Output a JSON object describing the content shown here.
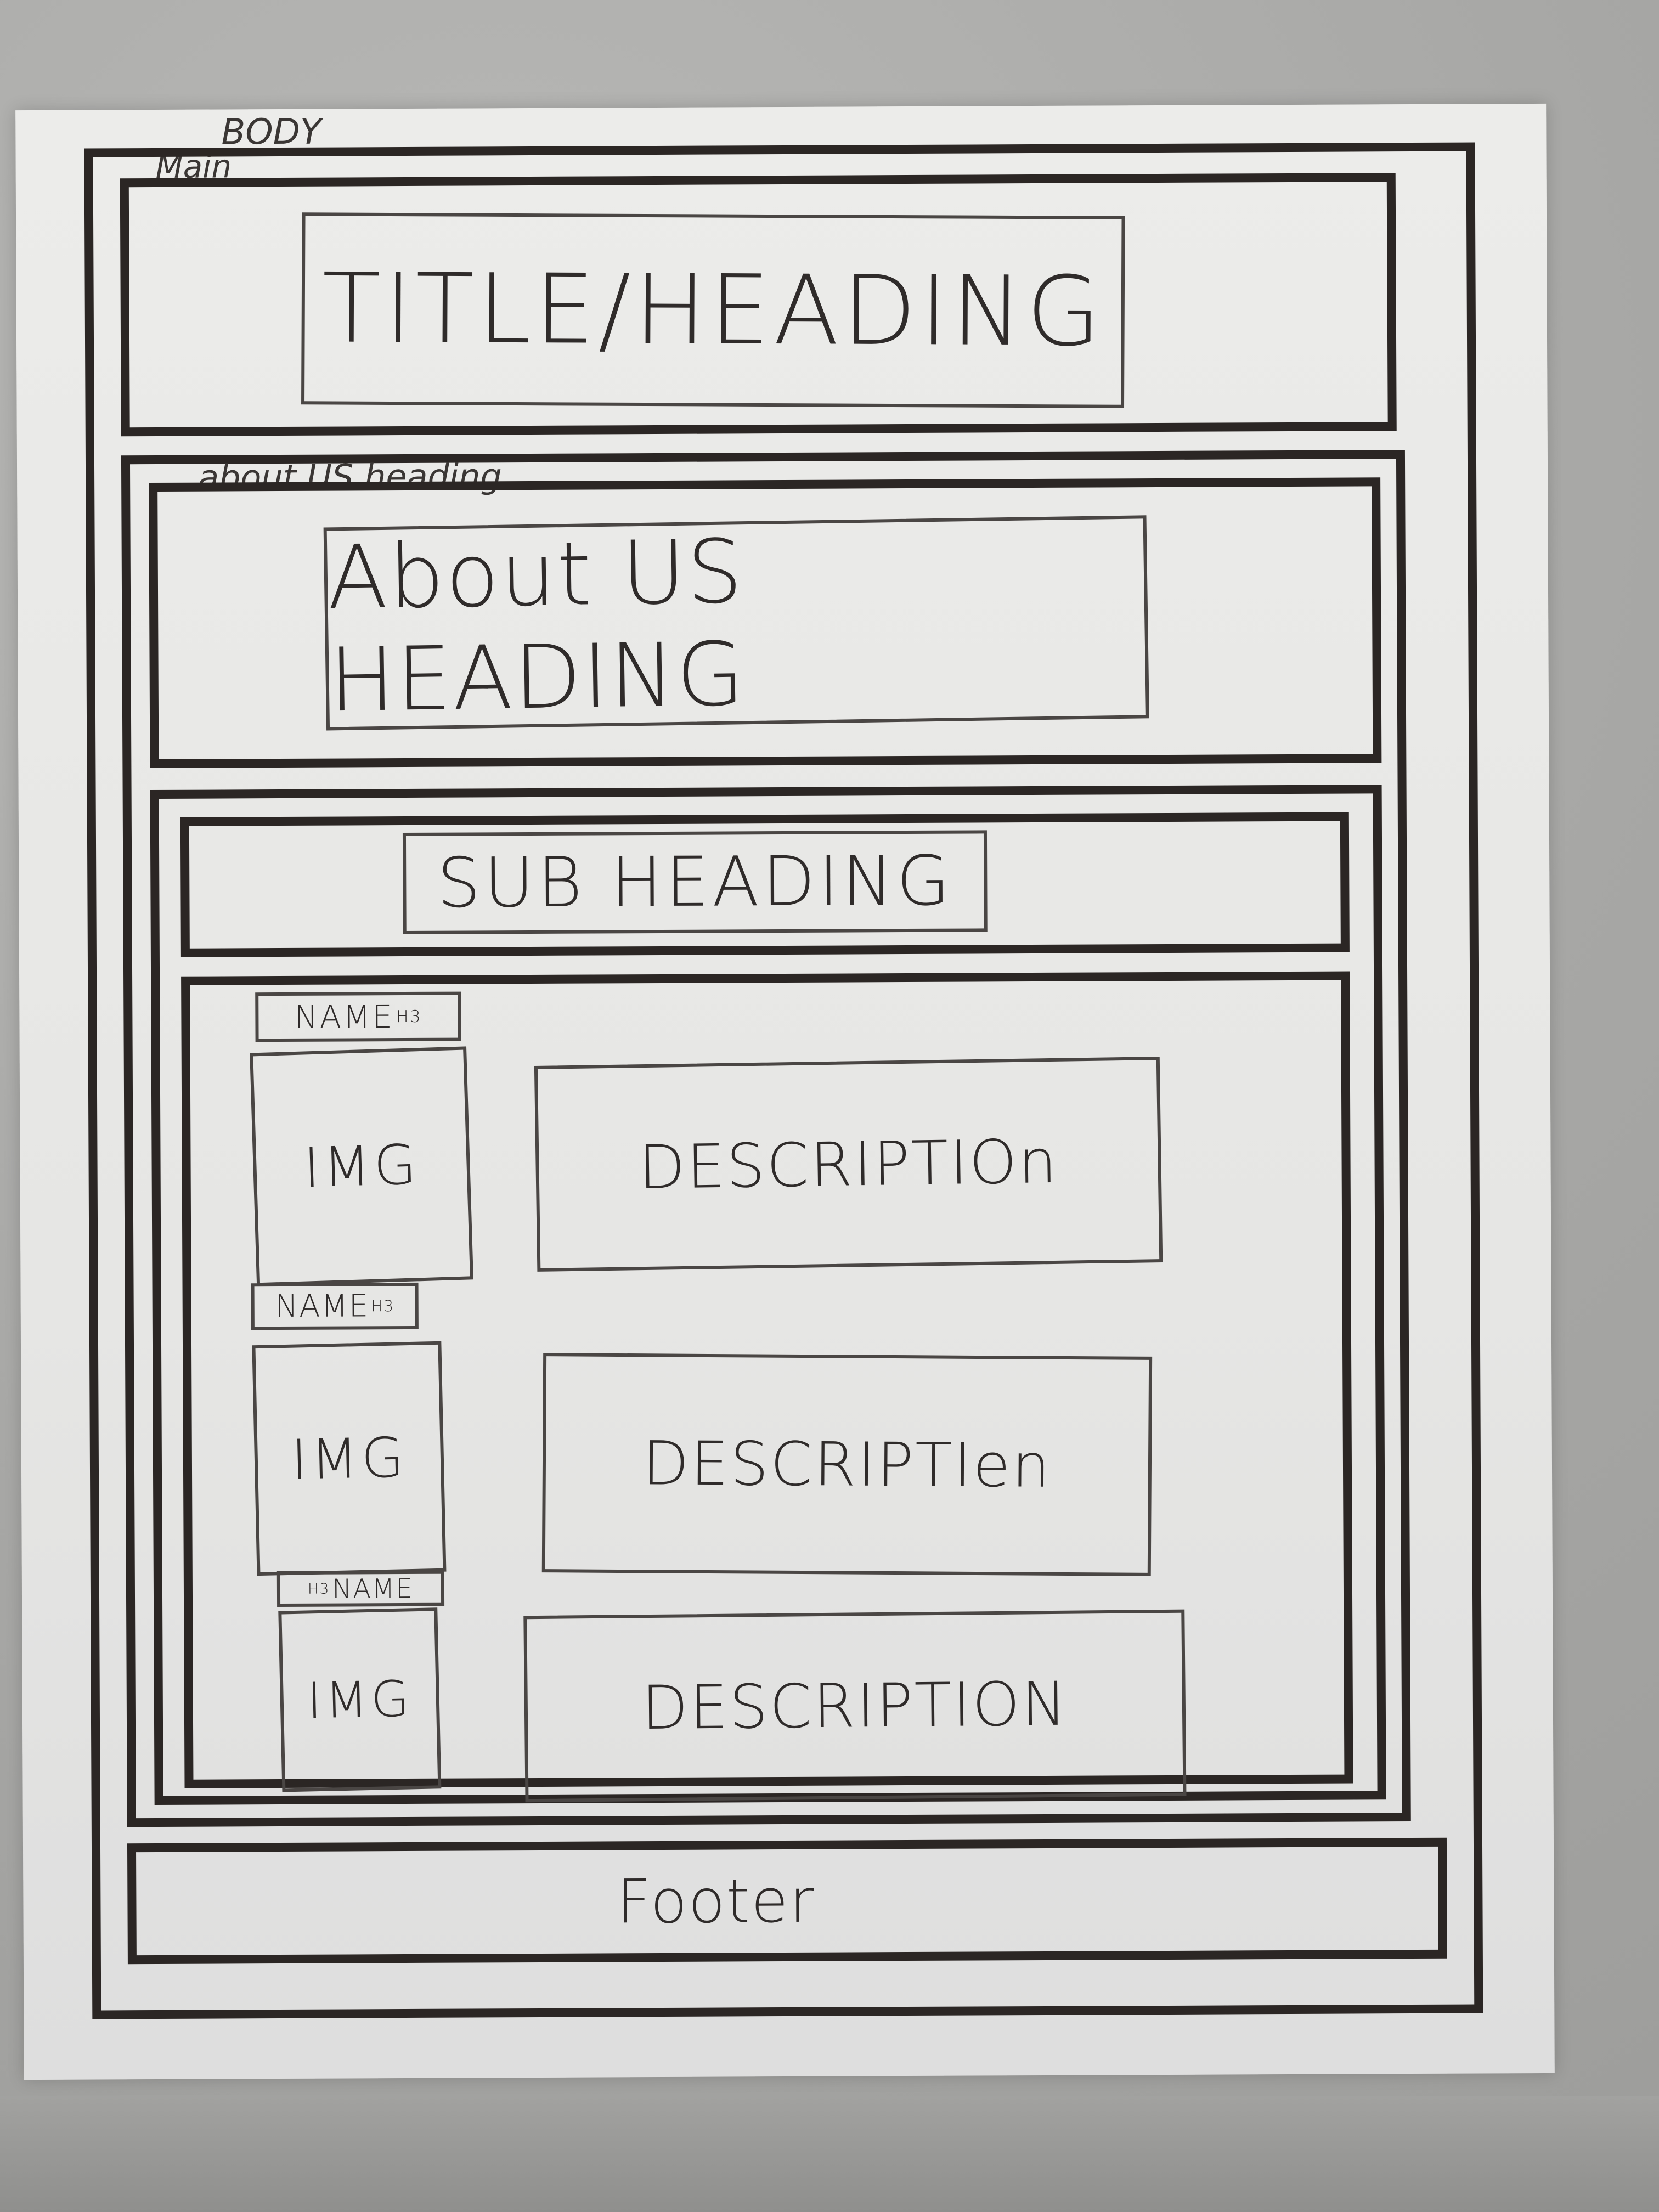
{
  "annotations": {
    "body": "BODY",
    "main": "Main",
    "about_us_section": "about US heading"
  },
  "header": {
    "title": "TITLE/HEADING"
  },
  "about_us": {
    "heading": "About US HEADING",
    "sub_heading": "SUB HEADING",
    "members": [
      {
        "name": "NAME",
        "name_tag": "H3",
        "image": "IMG",
        "description": "DESCRIPTIOn"
      },
      {
        "name": "NAME",
        "name_tag": "H3",
        "image": "IMG",
        "description": "DESCRIPTIen"
      },
      {
        "name": "NAME",
        "name_tag": "H3",
        "image": "IMG",
        "description": "DESCRIPTION"
      }
    ]
  },
  "footer": {
    "label": "Footer"
  }
}
